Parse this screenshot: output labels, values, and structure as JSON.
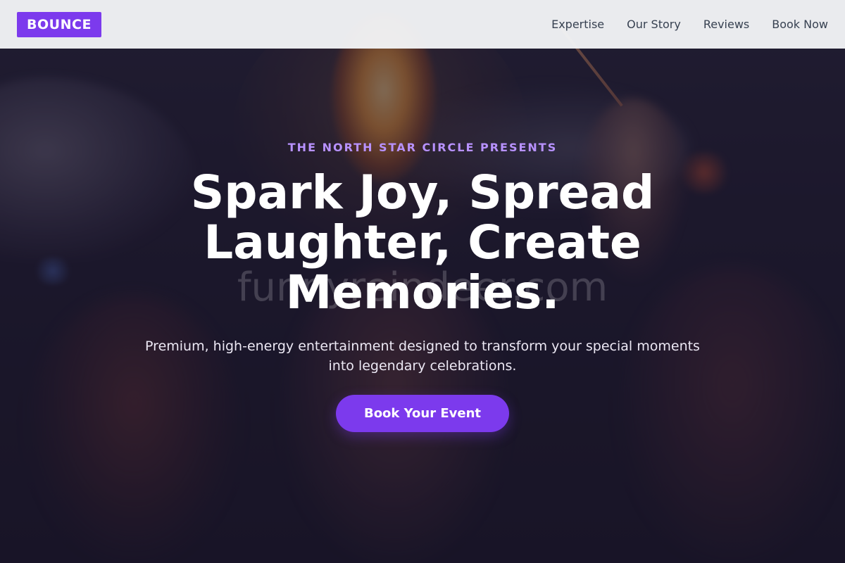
{
  "nav": {
    "logo": "BOUNCE",
    "links": [
      "Expertise",
      "Our Story",
      "Reviews",
      "Book Now"
    ]
  },
  "hero": {
    "eyebrow": "THE NORTH STAR CIRCLE PRESENTS",
    "headline_lines": [
      "Spark Joy, Spread",
      "Laughter, Create",
      "Memories."
    ],
    "watermark": "funnyreindeer.com",
    "subtext_lines": [
      "Premium, high-energy entertainment designed to transform your special moments",
      "into legendary celebrations."
    ],
    "cta_label": "Book Your Event"
  },
  "colors": {
    "brand": "#7c3aed",
    "eyebrow": "#b892ff",
    "nav_text": "#374151",
    "nav_bg": "#f3f4f6"
  }
}
